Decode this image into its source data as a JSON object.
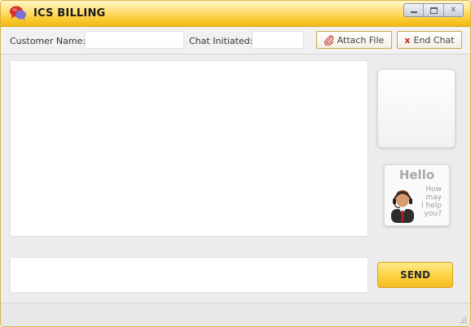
{
  "window": {
    "title": "ICS BILLING",
    "logo_icon": "chat-bubbles-icon",
    "controls": {
      "minimize_icon": "minimize-icon",
      "maximize_icon": "maximize-icon",
      "close_glyph": "x"
    }
  },
  "toolbar": {
    "customer_name_label": "Customer Name:",
    "customer_name_value": "",
    "chat_initiated_label": "Chat Initiated:",
    "chat_initiated_value": "",
    "attach_file_label": "Attach File",
    "attach_icon": "paperclip-icon",
    "end_chat_label": "End Chat",
    "end_chat_icon": "x",
    "end_chat_icon_color": "#cc1f1f"
  },
  "chat": {
    "transcript": "",
    "message_value": "",
    "send_label": "SEND"
  },
  "hello_card": {
    "title": "Hello",
    "lines": [
      "How",
      "may",
      "I help",
      "you?"
    ],
    "agent_icon": "support-agent-icon"
  },
  "colors": {
    "title_bar_accent": "#f9c92e",
    "send_button": "#fbcf3d",
    "button_border": "#c9a64a"
  }
}
